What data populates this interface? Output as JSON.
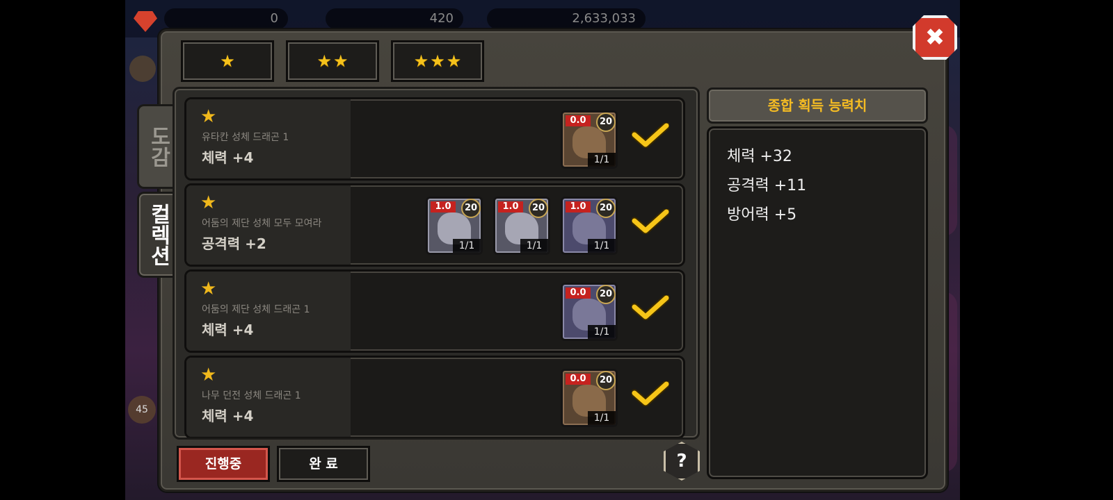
{
  "background": {
    "gems": "0",
    "crystals": "420",
    "gold": "2,633,033",
    "level_badge": "45"
  },
  "star_tabs": [
    {
      "stars": 1
    },
    {
      "stars": 2
    },
    {
      "stars": 3
    }
  ],
  "side_tabs": {
    "encyclopedia": "도감",
    "collection": "컬렉션"
  },
  "items": [
    {
      "title": "유타칸 성체 드래곤 1",
      "stat": "체력 +4",
      "cards": [
        {
          "ratio": "0.0",
          "level": "20",
          "count": "1/1",
          "style": "brown"
        }
      ]
    },
    {
      "title": "어둠의 제단 성체 모두 모여라",
      "stat": "공격력 +2",
      "cards": [
        {
          "ratio": "1.0",
          "level": "20",
          "count": "1/1",
          "style": "grey"
        },
        {
          "ratio": "1.0",
          "level": "20",
          "count": "1/1",
          "style": "grey"
        },
        {
          "ratio": "1.0",
          "level": "20",
          "count": "1/1",
          "style": "purple"
        }
      ]
    },
    {
      "title": "어둠의 제단 성체 드래곤 1",
      "stat": "체력 +4",
      "cards": [
        {
          "ratio": "0.0",
          "level": "20",
          "count": "1/1",
          "style": "purple"
        }
      ]
    },
    {
      "title": "나무 던전 성체 드래곤 1",
      "stat": "체력 +4",
      "cards": [
        {
          "ratio": "0.0",
          "level": "20",
          "count": "1/1",
          "style": "brown"
        }
      ]
    }
  ],
  "summary": {
    "header": "종합 획득 능력치",
    "lines": [
      "체력 +32",
      "공격력 +11",
      "방어력 +5"
    ]
  },
  "buttons": {
    "in_progress": "진행중",
    "complete": "완 료",
    "help": "?",
    "close": "✖"
  },
  "colors": {
    "accent_gold": "#f5bc23",
    "star": "#f6c21b",
    "active_button": "#9a2721",
    "close": "#d23a2c"
  }
}
